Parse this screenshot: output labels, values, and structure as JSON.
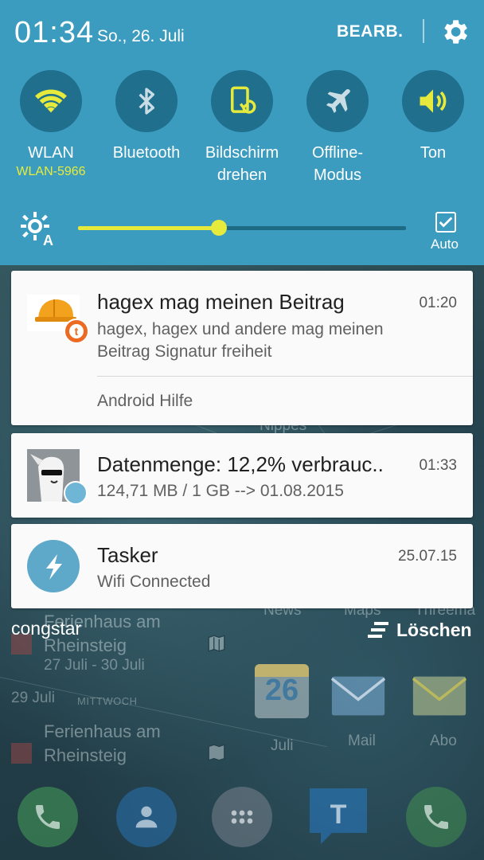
{
  "status": {
    "time": "01:34",
    "date": "So., 26. Juli",
    "edit_label": "BEARB."
  },
  "toggles": [
    {
      "label": "WLAN",
      "sub": "WLAN-5966",
      "icon": "wifi-icon",
      "active": true
    },
    {
      "label": "Bluetooth",
      "sub": "",
      "icon": "bluetooth-icon",
      "active": false
    },
    {
      "label": "Bildschirm\ndrehen",
      "sub": "",
      "icon": "screen-rotate-icon",
      "active": true
    },
    {
      "label": "Offline-\nModus",
      "sub": "",
      "icon": "airplane-icon",
      "active": false
    },
    {
      "label": "Ton",
      "sub": "",
      "icon": "sound-icon",
      "active": true
    }
  ],
  "brightness": {
    "level_percent": 43,
    "auto_label": "Auto",
    "auto_checked": true
  },
  "notifications": [
    {
      "title": "hagex mag meinen Beitrag",
      "time": "01:20",
      "text": "hagex, hagex und andere mag meinen\nBeitrag Signatur freiheit",
      "footer": "Android Hilfe",
      "icon": "tapatalk-avatar-icon"
    },
    {
      "title": "Datenmenge: 12,2% verbrauc..",
      "time": "01:33",
      "text": "124,71 MB / 1 GB --> 01.08.2015",
      "icon": "data-usage-avatar-icon"
    },
    {
      "title": "Tasker",
      "time": "25.07.15",
      "text": "Wifi Connected",
      "icon": "tasker-bolt-icon"
    }
  ],
  "bottom": {
    "carrier": "congstar",
    "clear_label": "Löschen"
  },
  "home_background": {
    "calendar_events": [
      {
        "title": "Ferienhaus am\nRheinsteig",
        "dates": "27 Juli - 30 Juli"
      },
      {
        "title": "Ferienhaus am\nRheinsteig"
      }
    ],
    "day_label": "29 Juli",
    "weekday_label": "MITTWOCH",
    "widget_row_labels": [
      "Nippes",
      "News",
      "Maps",
      "Threema"
    ],
    "app_labels": [
      "Juli",
      "Mail",
      "Abo"
    ],
    "calendar_day": "26"
  },
  "colors": {
    "panel": "#3b9cc0",
    "toggle_circle": "#1f6f8d",
    "accent_yellow": "#e6ea3d"
  }
}
